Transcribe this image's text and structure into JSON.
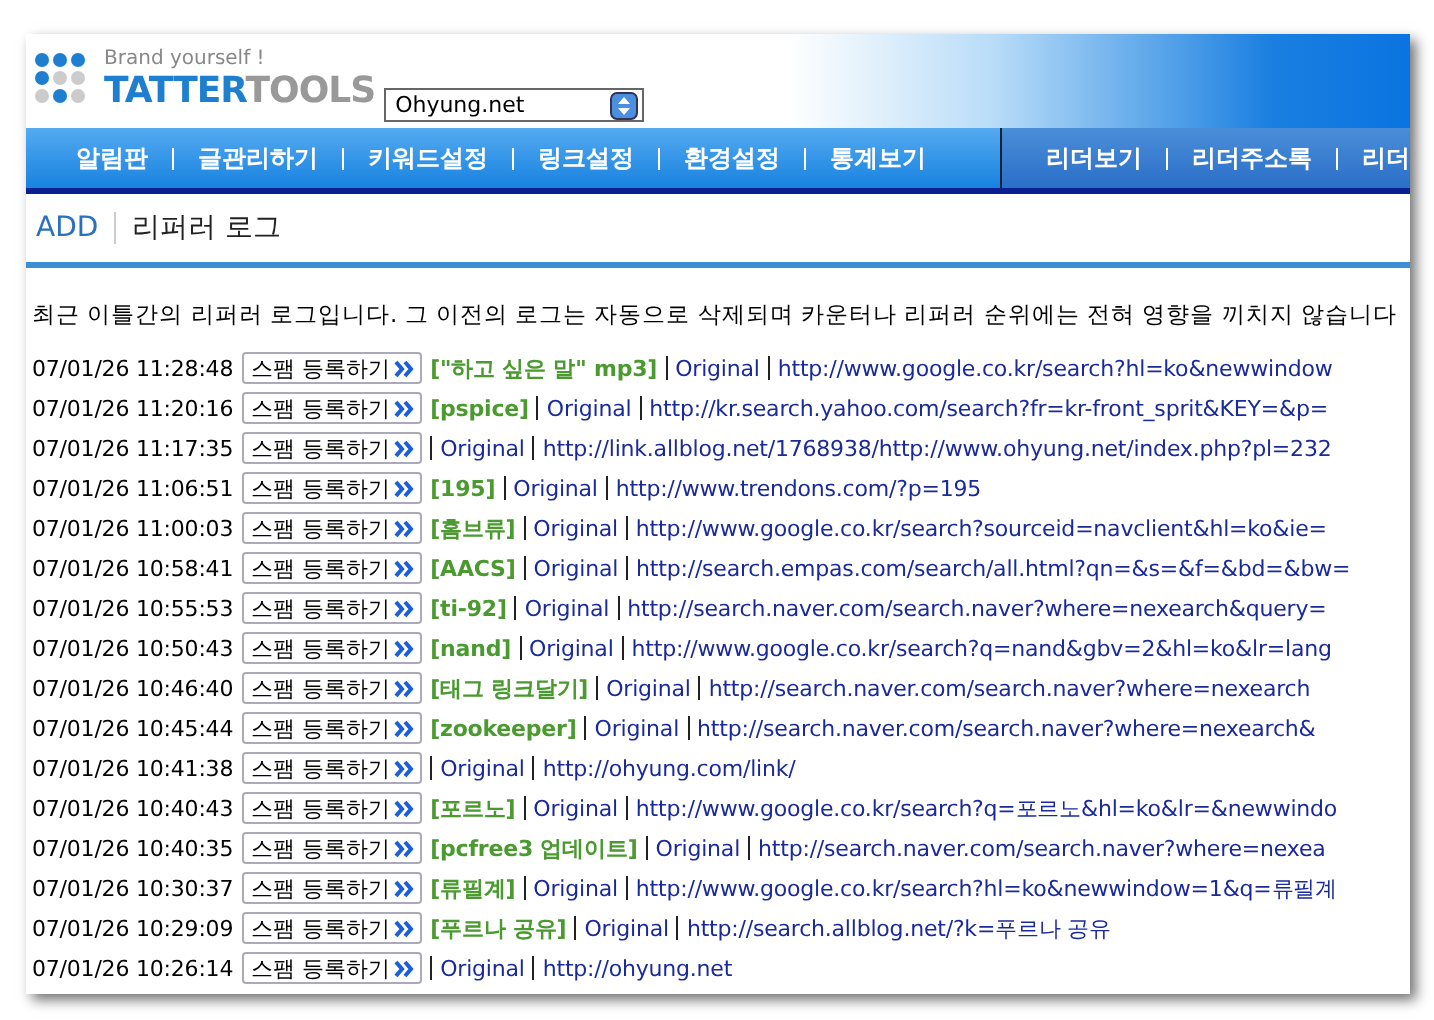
{
  "header": {
    "tagline": "Brand yourself !",
    "logo_primary": "TATTER",
    "logo_secondary": "TOOLS",
    "blog_select": "Ohyung.net"
  },
  "nav": {
    "main": [
      "알림판",
      "글관리하기",
      "키워드설정",
      "링크설정",
      "환경설정",
      "통계보기"
    ],
    "reader": [
      "리더보기",
      "리더주소록",
      "리더"
    ]
  },
  "page": {
    "section": "ADD",
    "title": "리퍼러 로그"
  },
  "description": "최근 이틀간의 리퍼러 로그입니다. 그 이전의 로그는 자동으로 삭제되며 카운터나 리퍼러 순위에는 전혀 영향을 끼치지 않습니다",
  "rows": [
    {
      "time": "07/01/26 11:28:48",
      "spam_button": "스팸 등록하기",
      "keyword": "[\"하고 싶은 말\" mp3]",
      "original": "Original",
      "url": "http://www.google.co.kr/search?hl=ko&newwindow"
    },
    {
      "time": "07/01/26 11:20:16",
      "spam_button": "스팸 등록하기",
      "keyword": "[pspice]",
      "original": "Original",
      "url": "http://kr.search.yahoo.com/search?fr=kr-front_sprit&KEY=&p="
    },
    {
      "time": "07/01/26 11:17:35",
      "spam_button": "스팸 등록하기",
      "original": "Original",
      "url": "http://link.allblog.net/1768938/http://www.ohyung.net/index.php?pl=232"
    },
    {
      "time": "07/01/26 11:06:51",
      "spam_button": "스팸 등록하기",
      "keyword": "[195]",
      "original": "Original",
      "url": "http://www.trendons.com/?p=195"
    },
    {
      "time": "07/01/26 11:00:03",
      "spam_button": "스팸 등록하기",
      "keyword": "[홈브류]",
      "original": "Original",
      "url": "http://www.google.co.kr/search?sourceid=navclient&hl=ko&ie="
    },
    {
      "time": "07/01/26 10:58:41",
      "spam_button": "스팸 등록하기",
      "keyword": "[AACS]",
      "original": "Original",
      "url": "http://search.empas.com/search/all.html?qn=&s=&f=&bd=&bw="
    },
    {
      "time": "07/01/26 10:55:53",
      "spam_button": "스팸 등록하기",
      "keyword": "[ti-92]",
      "original": "Original",
      "url": "http://search.naver.com/search.naver?where=nexearch&query="
    },
    {
      "time": "07/01/26 10:50:43",
      "spam_button": "스팸 등록하기",
      "keyword": "[nand]",
      "original": "Original",
      "url": "http://www.google.co.kr/search?q=nand&gbv=2&hl=ko&lr=lang"
    },
    {
      "time": "07/01/26 10:46:40",
      "spam_button": "스팸 등록하기",
      "keyword": "[태그 링크달기]",
      "original": "Original",
      "url": "http://search.naver.com/search.naver?where=nexearch"
    },
    {
      "time": "07/01/26 10:45:44",
      "spam_button": "스팸 등록하기",
      "keyword": "[zookeeper]",
      "original": "Original",
      "url": "http://search.naver.com/search.naver?where=nexearch&"
    },
    {
      "time": "07/01/26 10:41:38",
      "spam_button": "스팸 등록하기",
      "original": "Original",
      "url": "http://ohyung.com/link/"
    },
    {
      "time": "07/01/26 10:40:43",
      "spam_button": "스팸 등록하기",
      "keyword": "[포르노]",
      "original": "Original",
      "url": "http://www.google.co.kr/search?q=포르노&hl=ko&lr=&newwindo"
    },
    {
      "time": "07/01/26 10:40:35",
      "spam_button": "스팸 등록하기",
      "keyword": "[pcfree3 업데이트]",
      "original": "Original",
      "url": "http://search.naver.com/search.naver?where=nexea"
    },
    {
      "time": "07/01/26 10:30:37",
      "spam_button": "스팸 등록하기",
      "keyword": "[류필계]",
      "original": "Original",
      "url": "http://www.google.co.kr/search?hl=ko&newwindow=1&q=류필계"
    },
    {
      "time": "07/01/26 10:29:09",
      "spam_button": "스팸 등록하기",
      "keyword": "[푸르나 공유]",
      "original": "Original",
      "url": "http://search.allblog.net/?k=푸르나 공유"
    },
    {
      "time": "07/01/26 10:26:14",
      "spam_button": "스팸 등록하기",
      "original": "Original",
      "url": "http://ohyung.net"
    }
  ]
}
